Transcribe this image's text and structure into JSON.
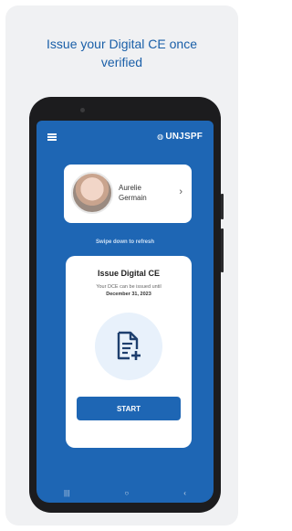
{
  "headline": {
    "line1": "Issue your Digital CE once",
    "line2": "verified"
  },
  "app": {
    "brand": "UNJSPF",
    "brand_icon": "un-emblem-icon",
    "menu_icon": "hamburger-menu-icon"
  },
  "profile": {
    "first_name": "Aurelie",
    "last_name": "Germain",
    "chevron": "›"
  },
  "refresh_hint": "Swipe down to refresh",
  "issue_card": {
    "title": "Issue Digital CE",
    "subtitle": "Your DCE can be issued until",
    "deadline": "December 31, 2023",
    "start_label": "START"
  },
  "navbar": {
    "recent": "|||",
    "home": "○",
    "back": "‹"
  },
  "colors": {
    "brand_blue": "#1e66b4",
    "headline_blue": "#1a5fa8",
    "doc_circle": "#e8f1fb"
  }
}
